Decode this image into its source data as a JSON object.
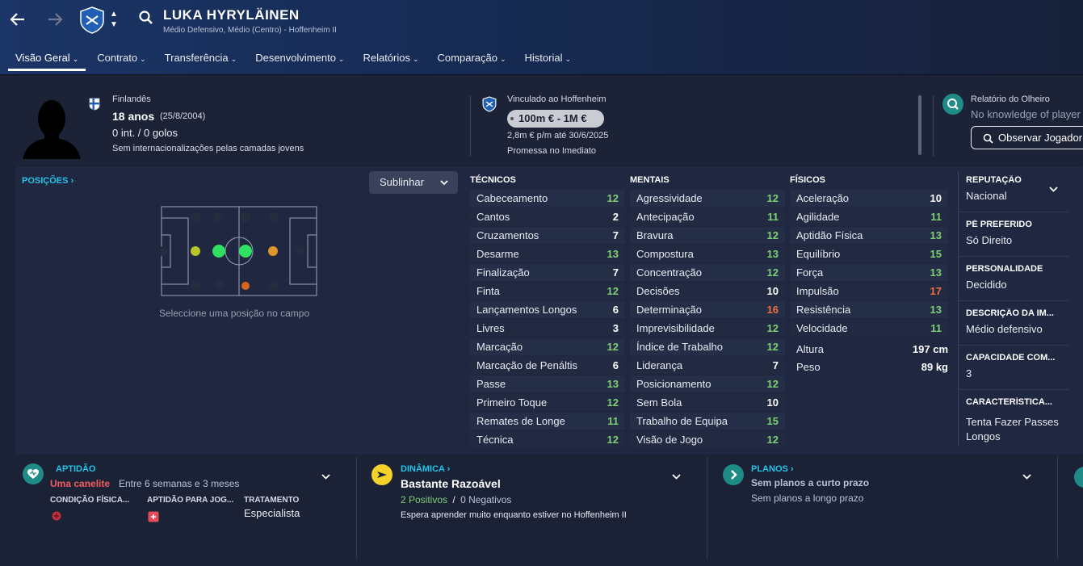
{
  "header": {
    "player_name": "LUKA HYRYLÄINEN",
    "subtitle": "Médio Defensivo, Médio (Centro) - Hoffenheim II",
    "icons": [
      "back-arrow-icon",
      "forward-arrow-icon",
      "club-crest-icon",
      "sort-arrows-icon",
      "search-icon"
    ]
  },
  "tabs": [
    {
      "label": "Visão Geral"
    },
    {
      "label": "Contrato"
    },
    {
      "label": "Transferência"
    },
    {
      "label": "Desenvolvimento"
    },
    {
      "label": "Relatórios"
    },
    {
      "label": "Comparação"
    },
    {
      "label": "Historial"
    }
  ],
  "profile": {
    "nationality": "Finlandês",
    "age": "18 anos",
    "birth": "(25/8/2004)",
    "caps": "0 int. / 0 golos",
    "youth": "Sem internacionalizações pelas camadas jovens"
  },
  "contract": {
    "club": "Vinculado ao Hoffenheim",
    "value": "100m € - 1M €",
    "wage": "2,8m € p/m até 30/6/2025",
    "status": "Promessa no Imediato"
  },
  "scout": {
    "title": "Relatório do Olheiro",
    "text": "No knowledge of player",
    "button": "Observar Jogador"
  },
  "positions": {
    "title": "POSIÇÕES",
    "dropdown": "Sublinhar",
    "hint": "Seleccione uma posição no campo"
  },
  "attributes": {
    "tecnicos_title": "TÉCNICOS",
    "mentais_title": "MENTAIS",
    "fisicos_title": "FÍSICOS",
    "tecnicos": [
      {
        "name": "Cabeceamento",
        "value": "12"
      },
      {
        "name": "Cantos",
        "value": "2"
      },
      {
        "name": "Cruzamentos",
        "value": "7"
      },
      {
        "name": "Desarme",
        "value": "13"
      },
      {
        "name": "Finalização",
        "value": "7"
      },
      {
        "name": "Finta",
        "value": "12"
      },
      {
        "name": "Lançamentos Longos",
        "value": "6"
      },
      {
        "name": "Livres",
        "value": "3"
      },
      {
        "name": "Marcação",
        "value": "12"
      },
      {
        "name": "Marcação de Penáltis",
        "value": "6"
      },
      {
        "name": "Passe",
        "value": "13"
      },
      {
        "name": "Primeiro Toque",
        "value": "12"
      },
      {
        "name": "Remates de Longe",
        "value": "11"
      },
      {
        "name": "Técnica",
        "value": "12"
      }
    ],
    "mentais": [
      {
        "name": "Agressividade",
        "value": "12"
      },
      {
        "name": "Antecipação",
        "value": "11"
      },
      {
        "name": "Bravura",
        "value": "12"
      },
      {
        "name": "Compostura",
        "value": "13"
      },
      {
        "name": "Concentração",
        "value": "12"
      },
      {
        "name": "Decisões",
        "value": "10"
      },
      {
        "name": "Determinação",
        "value": "16"
      },
      {
        "name": "Imprevisibilidade",
        "value": "12"
      },
      {
        "name": "Índice de Trabalho",
        "value": "12"
      },
      {
        "name": "Liderança",
        "value": "7"
      },
      {
        "name": "Posicionamento",
        "value": "12"
      },
      {
        "name": "Sem Bola",
        "value": "10"
      },
      {
        "name": "Trabalho de Equipa",
        "value": "15"
      },
      {
        "name": "Visão de Jogo",
        "value": "12"
      }
    ],
    "fisicos": [
      {
        "name": "Aceleração",
        "value": "10"
      },
      {
        "name": "Agilidade",
        "value": "11"
      },
      {
        "name": "Aptidão Física",
        "value": "13"
      },
      {
        "name": "Equilíbrio",
        "value": "15"
      },
      {
        "name": "Força",
        "value": "13"
      },
      {
        "name": "Impulsão",
        "value": "17"
      },
      {
        "name": "Resistência",
        "value": "13"
      },
      {
        "name": "Velocidade",
        "value": "11"
      }
    ],
    "altura_label": "Altura",
    "altura": "197 cm",
    "peso_label": "Peso",
    "peso": "89 kg"
  },
  "side_info": [
    {
      "label": "REPUTAÇÃO",
      "value": "Nacional"
    },
    {
      "label": "PÉ PREFERIDO",
      "value": "Só Direito"
    },
    {
      "label": "PERSONALIDADE",
      "value": "Decidido"
    },
    {
      "label": "DESCRIÇÃO DA IM...",
      "value": "Médio defensivo"
    },
    {
      "label": "CAPACIDADE COM...",
      "value": "3"
    },
    {
      "label": "CARACTERÍSTICA...",
      "value": "Tenta Fazer Passes Longos"
    }
  ],
  "aptidao": {
    "title": "APTIDÃO",
    "injury": "Uma canelite",
    "duration": "Entre 6 semanas e 3 meses",
    "cond_label": "CONDIÇÃO FÍSICA...",
    "apt_label": "APTIDÃO PARA JOG...",
    "treat_label": "TRATAMENTO",
    "treat_value": "Especialista"
  },
  "dinamica": {
    "title": "DINÂMICA",
    "summary": "Bastante Razoável",
    "positives": "2 Positivos",
    "separator": "/",
    "negatives": "0 Negativos",
    "note": "Espera aprender muito enquanto estiver no Hoffenheim II"
  },
  "planos": {
    "title": "PLANOS",
    "short": "Sem planos a curto prazo",
    "long": "Sem planos a longo prazo"
  },
  "colors": {
    "accent": "#25c3e8",
    "high": "#7fcf76",
    "orange": "#f0703f",
    "injury": "#f25c5c"
  }
}
